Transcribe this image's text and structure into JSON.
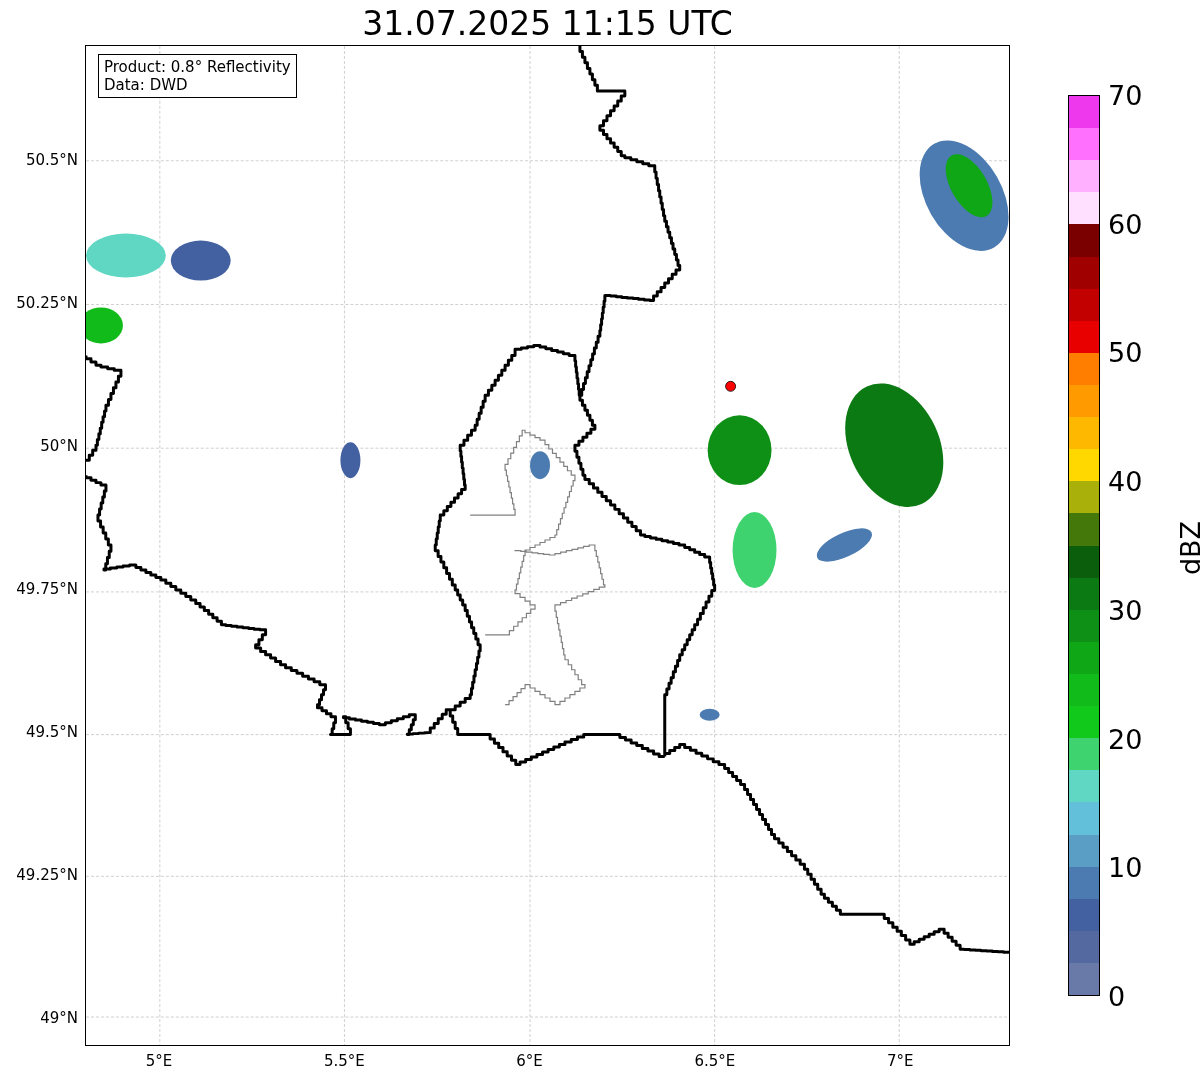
{
  "title": "31.07.2025 11:15 UTC",
  "map": {
    "info_box": [
      "Product: 0.8° Reflectivity",
      "Data: DWD"
    ],
    "y_ticks": [
      "50.5°N",
      "50.25°N",
      "50°N",
      "49.75°N",
      "49.5°N",
      "49.25°N",
      "49°N"
    ],
    "x_ticks": [
      "5°E",
      "5.5°E",
      "6°E",
      "6.5°E",
      "7°E"
    ]
  },
  "colorbar": {
    "label": "dBZ",
    "ticks": [
      "70",
      "60",
      "50",
      "40",
      "30",
      "20",
      "10",
      "0"
    ],
    "steps": [
      {
        "color": "#6a7aa8"
      },
      {
        "color": "#54699f"
      },
      {
        "color": "#4360a0"
      },
      {
        "color": "#4b7bb0"
      },
      {
        "color": "#5a9ec6"
      },
      {
        "color": "#62c0da"
      },
      {
        "color": "#5fd7c3"
      },
      {
        "color": "#3ed36e"
      },
      {
        "color": "#10c91a"
      },
      {
        "color": "#10bb1a"
      },
      {
        "color": "#0fa715"
      },
      {
        "color": "#0e9016"
      },
      {
        "color": "#0b7a12"
      },
      {
        "color": "#0a5e0c"
      },
      {
        "color": "#44780a"
      },
      {
        "color": "#aab00a"
      },
      {
        "color": "#ffd800"
      },
      {
        "color": "#ffb800"
      },
      {
        "color": "#ff9a00"
      },
      {
        "color": "#ff7e00"
      },
      {
        "color": "#e80000"
      },
      {
        "color": "#c20000"
      },
      {
        "color": "#a00000"
      },
      {
        "color": "#7a0000"
      },
      {
        "color": "#ffe0ff"
      },
      {
        "color": "#ffb0ff"
      },
      {
        "color": "#ff70ff"
      },
      {
        "color": "#ee38ee"
      }
    ]
  }
}
